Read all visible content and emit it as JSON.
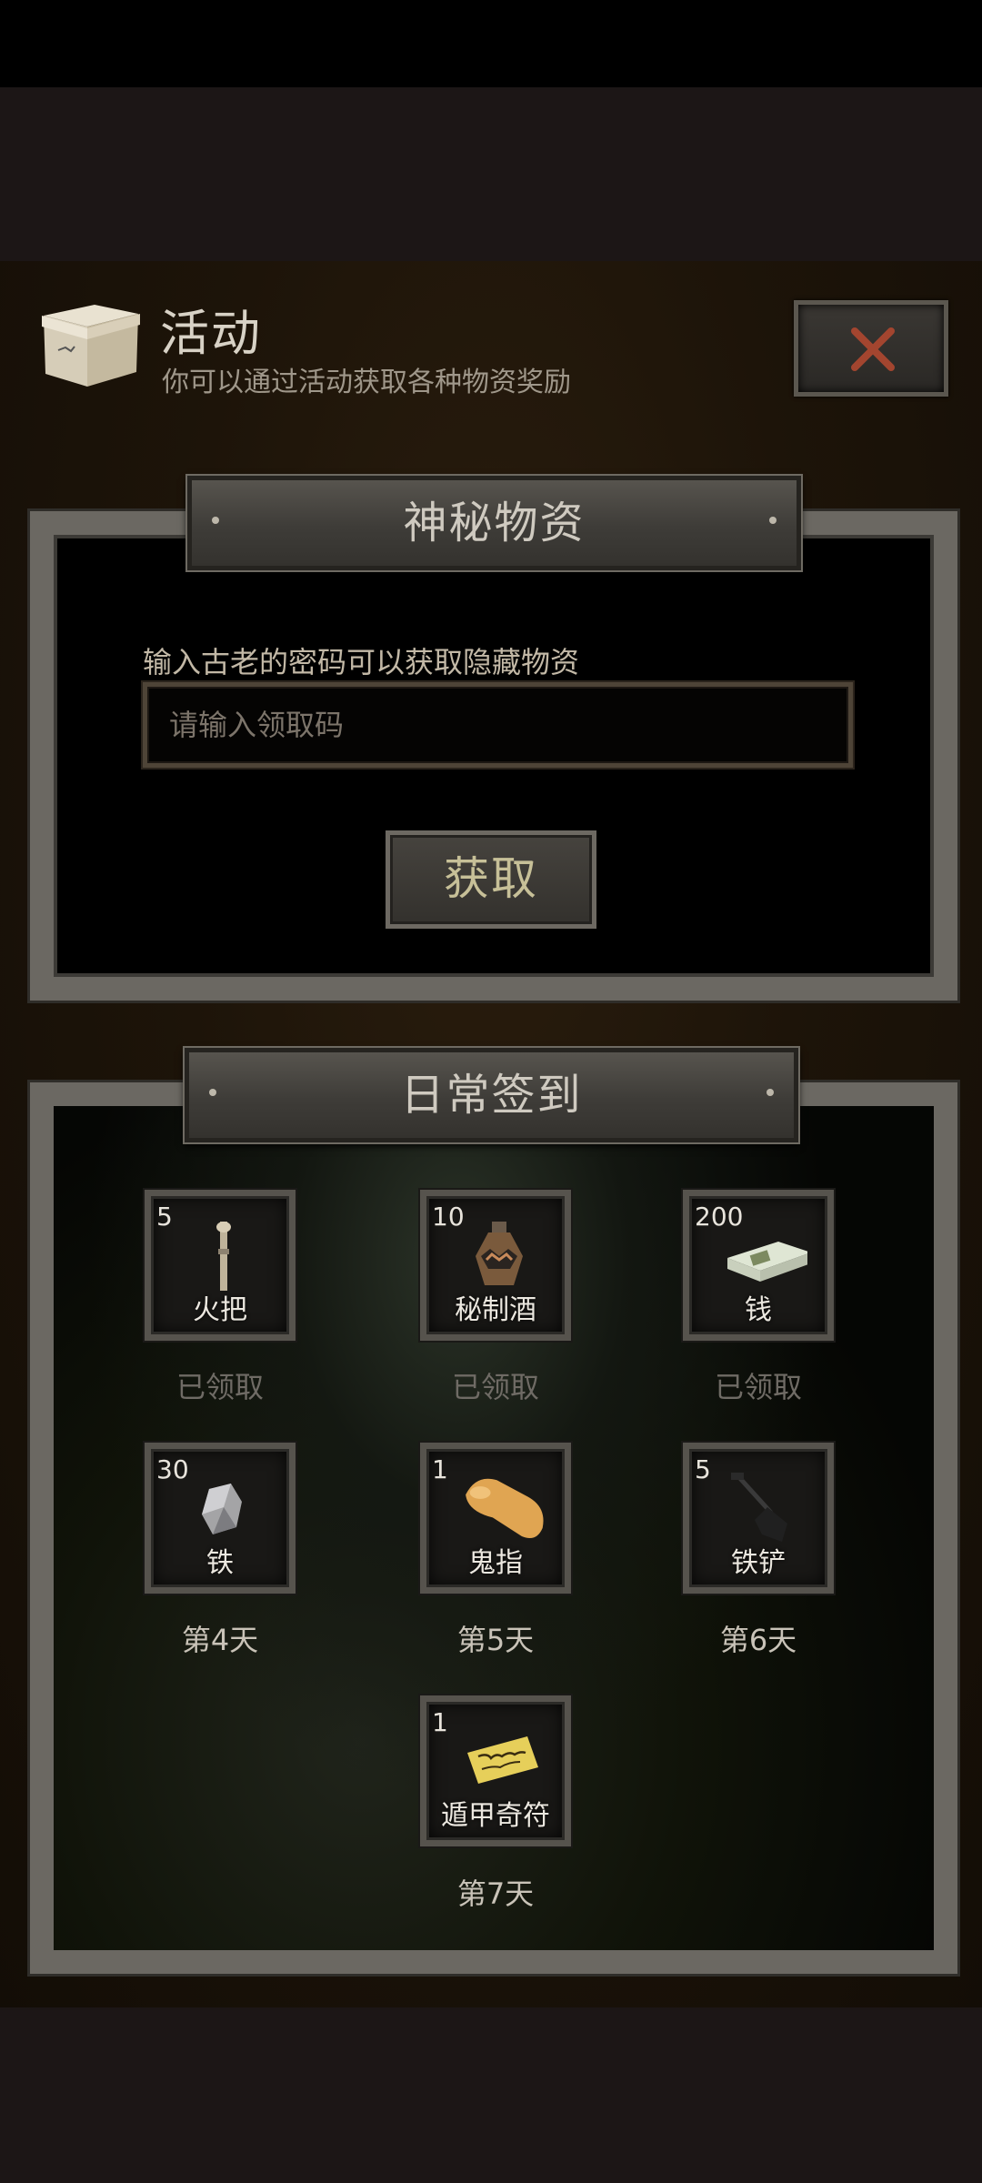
{
  "header": {
    "title": "活动",
    "subtitle": "你可以通过活动获取各种物资奖励",
    "close_icon": "close-icon"
  },
  "mystery": {
    "title": "神秘物资",
    "hint": "输入古老的密码可以获取隐藏物资",
    "input_placeholder": "请输入领取码",
    "button_label": "获取"
  },
  "checkin": {
    "title": "日常签到",
    "items": [
      {
        "count": "5",
        "name": "火把",
        "status": "已领取",
        "icon": "torch-icon"
      },
      {
        "count": "10",
        "name": "秘制酒",
        "status": "已领取",
        "icon": "wine-jar-icon"
      },
      {
        "count": "200",
        "name": "钱",
        "status": "已领取",
        "icon": "money-stack-icon"
      },
      {
        "count": "30",
        "name": "铁",
        "status": "第4天",
        "icon": "iron-ore-icon"
      },
      {
        "count": "1",
        "name": "鬼指",
        "status": "第5天",
        "icon": "ghost-finger-icon"
      },
      {
        "count": "5",
        "name": "铁铲",
        "status": "第6天",
        "icon": "shovel-icon"
      },
      {
        "count": "1",
        "name": "遁甲奇符",
        "status": "第7天",
        "icon": "talisman-icon"
      }
    ]
  },
  "colors": {
    "accent_close": "#a3452f",
    "claimed_text": "#6f6b65",
    "day_text": "#c9c3b8"
  }
}
